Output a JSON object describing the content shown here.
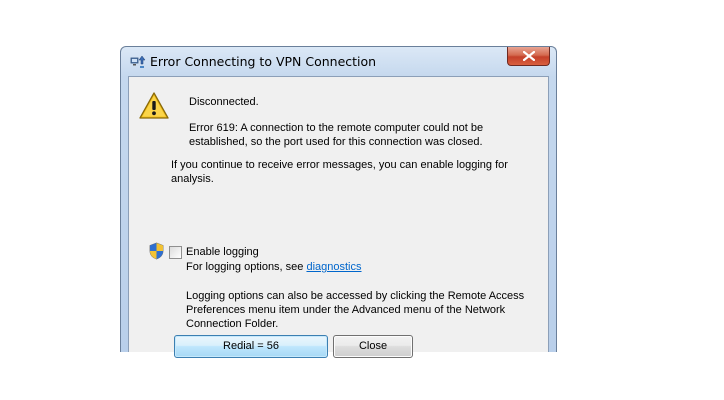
{
  "window": {
    "title": "Error Connecting to VPN Connection",
    "icon": "network-connection-icon",
    "close_icon": "close-icon"
  },
  "message": {
    "icon": "warning-icon",
    "status": "Disconnected.",
    "error_line1": "Error 619: A connection to the remote computer could not be",
    "error_line2": "established, so the port used for this connection was closed.",
    "info_line1": "If you continue to receive error messages, you can enable logging for",
    "info_line2": "analysis."
  },
  "logging": {
    "shield_icon": "uac-shield-icon",
    "checkbox_label": "Enable logging",
    "checked": false,
    "options_prefix": "For logging options, see ",
    "link_text": "diagnostics",
    "note_line1": "Logging options can also be accessed by clicking the Remote Access",
    "note_line2": "Preferences menu item under the Advanced menu of the Network",
    "note_line3": "Connection Folder."
  },
  "buttons": {
    "redial_label": "Redial = 56",
    "close_label": "Close"
  }
}
